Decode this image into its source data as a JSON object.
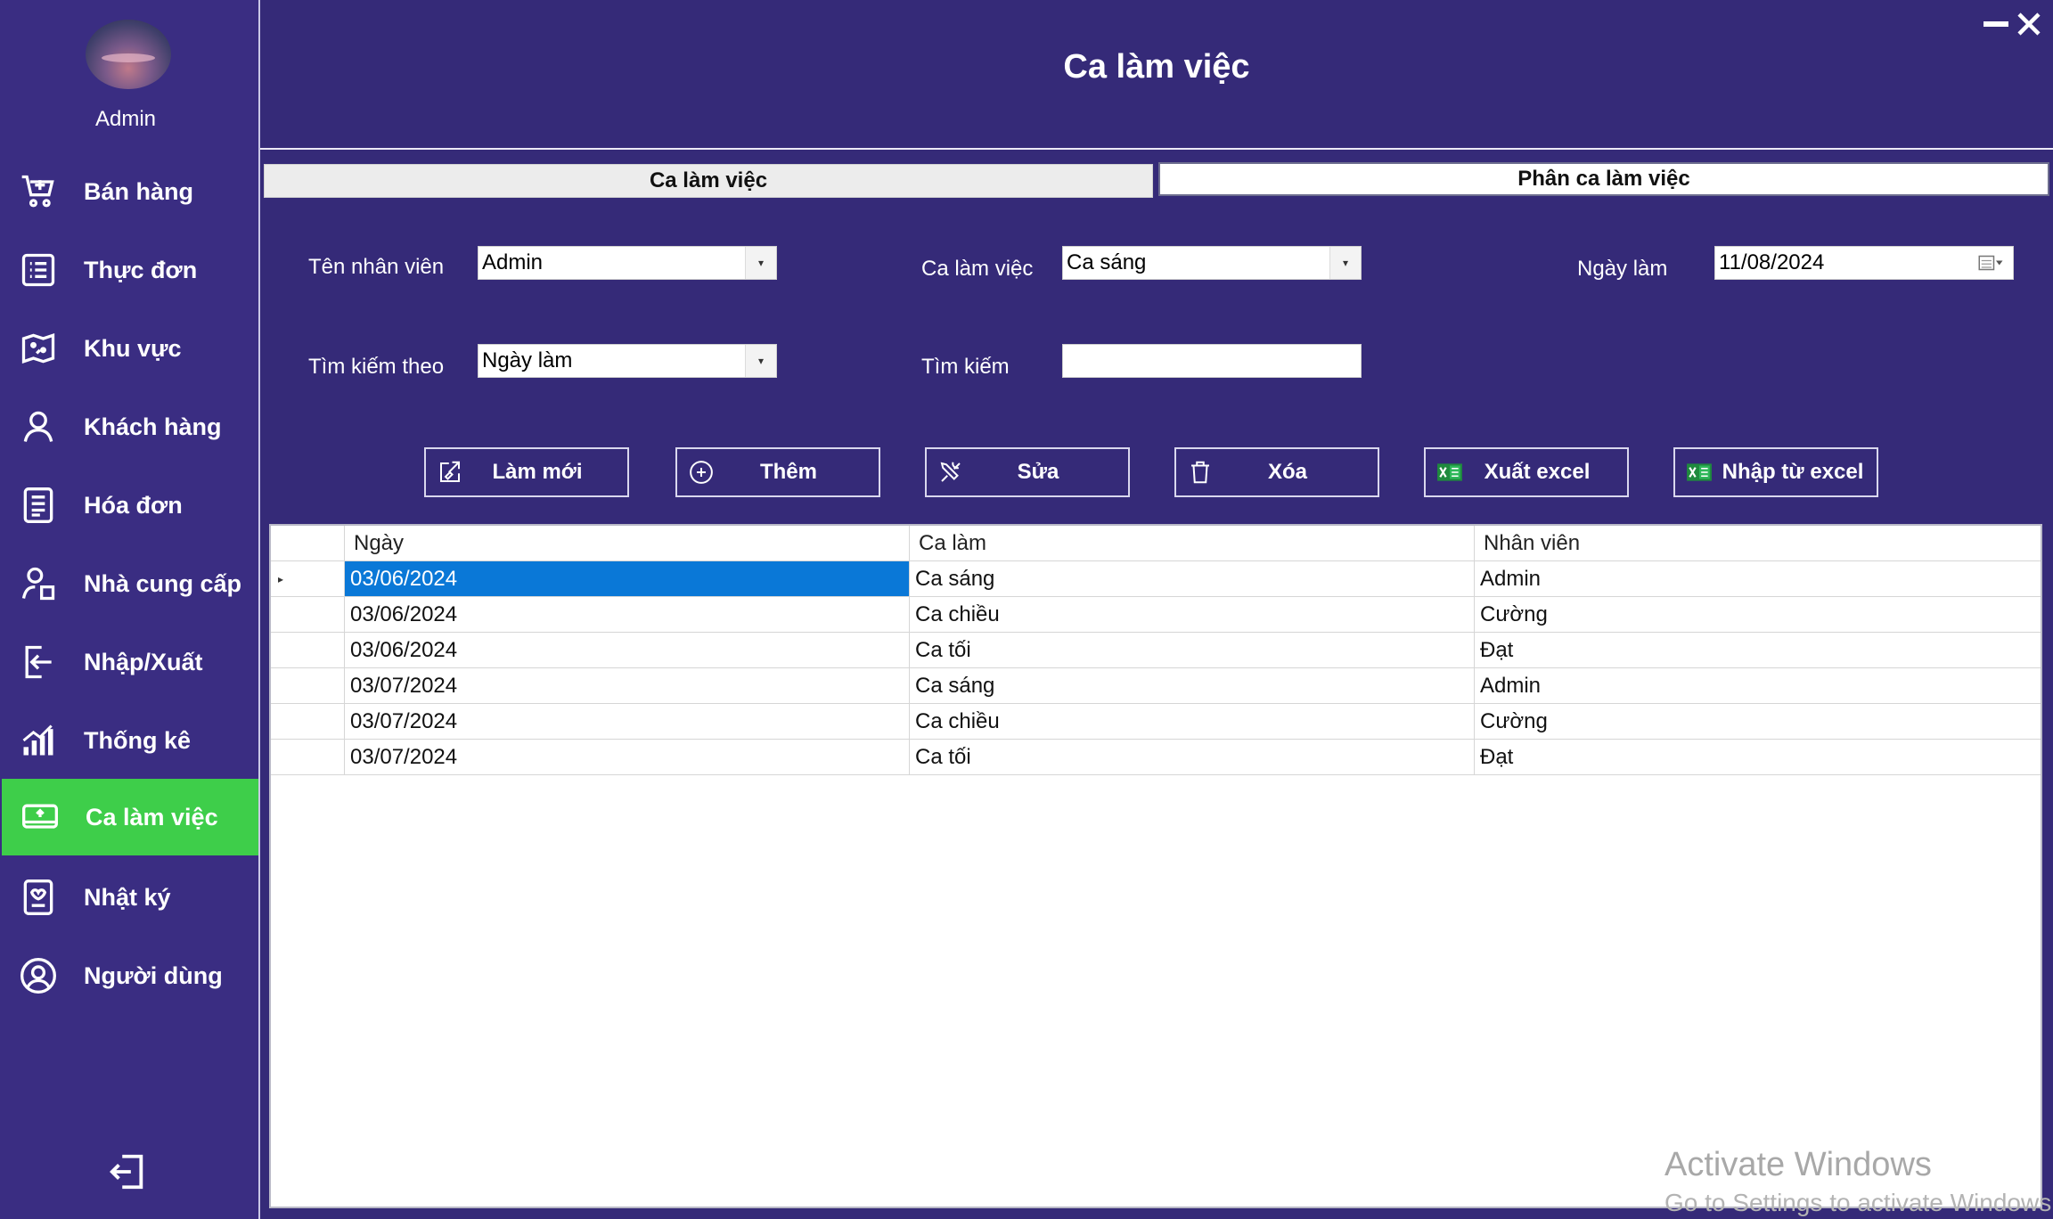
{
  "window": {
    "title": "Ca làm việc",
    "minimize_icon": "minimize-icon",
    "close_icon": "close-icon"
  },
  "user": {
    "name": "Admin"
  },
  "sidebar": {
    "items": [
      {
        "label": "Bán hàng",
        "icon": "cart-icon"
      },
      {
        "label": "Thực đơn",
        "icon": "menu-list-icon"
      },
      {
        "label": "Khu vực",
        "icon": "map-icon"
      },
      {
        "label": "Khách hàng",
        "icon": "user-icon"
      },
      {
        "label": "Hóa đơn",
        "icon": "invoice-icon"
      },
      {
        "label": "Nhà cung cấp",
        "icon": "supplier-icon"
      },
      {
        "label": "Nhập/Xuất",
        "icon": "import-export-icon"
      },
      {
        "label": "Thống kê",
        "icon": "stats-icon"
      },
      {
        "label": "Ca làm việc",
        "icon": "shift-icon",
        "active": true
      },
      {
        "label": "Nhật ký",
        "icon": "log-icon"
      },
      {
        "label": "Người dùng",
        "icon": "user-circle-icon"
      }
    ],
    "active_color": "#3ece4a"
  },
  "tabs": [
    {
      "label": "Ca làm việc"
    },
    {
      "label": "Phân ca làm việc"
    }
  ],
  "form": {
    "employee_label": "Tên nhân viên",
    "employee_value": "Admin",
    "shift_label": "Ca làm việc",
    "shift_value": "Ca sáng",
    "date_label": "Ngày làm",
    "date_value": "11/08/2024",
    "search_by_label": "Tìm kiếm theo",
    "search_by_value": "Ngày làm",
    "search_label": "Tìm kiếm",
    "search_value": ""
  },
  "actions": {
    "refresh": "Làm mới",
    "add": "Thêm",
    "edit": "Sửa",
    "delete": "Xóa",
    "export": "Xuất excel",
    "import": "Nhập từ excel"
  },
  "table": {
    "headers": [
      "Ngày",
      "Ca làm",
      "Nhân viên"
    ],
    "rows": [
      [
        "03/06/2024",
        "Ca sáng",
        "Admin"
      ],
      [
        "03/06/2024",
        "Ca chiều",
        "Cường"
      ],
      [
        "03/06/2024",
        "Ca tối",
        "Đạt"
      ],
      [
        "03/07/2024",
        "Ca sáng",
        "Admin"
      ],
      [
        "03/07/2024",
        "Ca chiều",
        "Cường"
      ],
      [
        "03/07/2024",
        "Ca tối",
        "Đạt"
      ]
    ],
    "selected_row": 0,
    "selected_color": "#0a78d7"
  },
  "watermark": {
    "line1": "Activate Windows",
    "line2": "Go to Settings to activate Windows."
  }
}
